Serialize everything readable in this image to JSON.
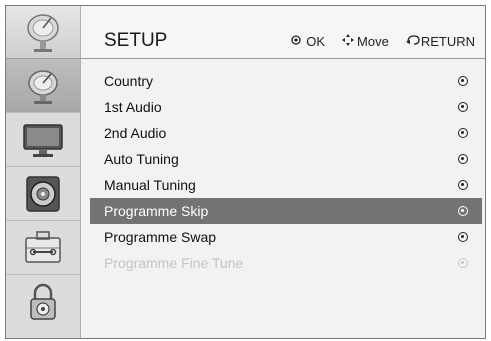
{
  "header": {
    "title": "SETUP",
    "hints": [
      {
        "icon": "ok-icon",
        "label": "OK"
      },
      {
        "icon": "move-icon",
        "label": "Move"
      },
      {
        "icon": "return-icon",
        "label": "RETURN"
      }
    ]
  },
  "sidebar": {
    "items": [
      {
        "icon": "satellite-dish-icon",
        "active": true
      },
      {
        "icon": "monitor-icon",
        "active": false
      },
      {
        "icon": "speaker-icon",
        "active": false
      },
      {
        "icon": "toolbox-icon",
        "active": false
      },
      {
        "icon": "lock-icon",
        "active": false
      }
    ]
  },
  "menu": {
    "items": [
      {
        "label": "Country",
        "state": "normal"
      },
      {
        "label": "1st Audio",
        "state": "normal"
      },
      {
        "label": "2nd Audio",
        "state": "normal"
      },
      {
        "label": "Auto Tuning",
        "state": "normal"
      },
      {
        "label": "Manual Tuning",
        "state": "normal"
      },
      {
        "label": "Programme Skip",
        "state": "selected"
      },
      {
        "label": "Programme Swap",
        "state": "normal"
      },
      {
        "label": "Programme Fine Tune",
        "state": "disabled"
      }
    ]
  }
}
